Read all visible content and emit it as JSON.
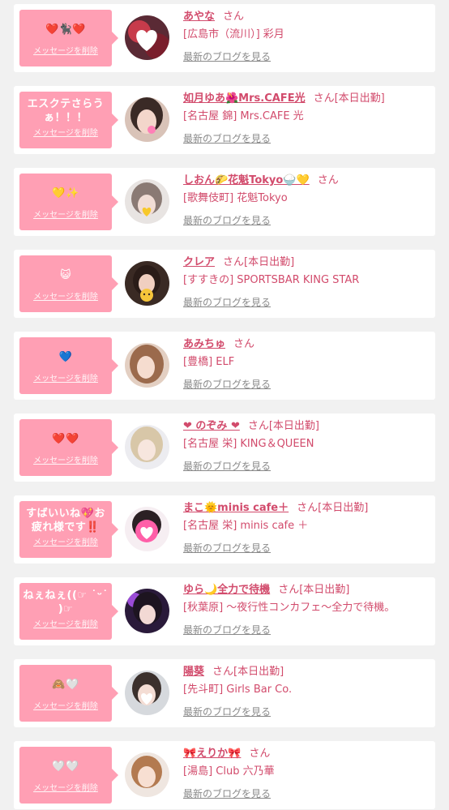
{
  "colors": {
    "page_bg": "#f1f1f1",
    "bubble_pink": "#ff9fb4",
    "name_pink": "#d24b6c",
    "link_gray": "#8a8a8a"
  },
  "delete_label": "メッセージを削除",
  "blog_label": "最新のブログを見る",
  "items": [
    {
      "message": "❤️🐈‍⬛❤️",
      "name": "あやな",
      "san": "さん",
      "tag": "",
      "shop": "[広島市（流川）] 彩月",
      "avatar_icon": "heart-sticker-avatar"
    },
    {
      "message": "エスクテさらうぁ！！！",
      "name": "如月ゆあ🌺Mrs.CAFE光",
      "san": "さん",
      "tag": "[本日出勤]",
      "shop": "[名古屋 錦] Mrs.CAFE 光",
      "avatar_icon": "heart-sticker-avatar"
    },
    {
      "message": "💛✨",
      "name": "しおん🌮花魁Tokyo🍚💛",
      "san": "さん",
      "tag": "",
      "shop": "[歌舞伎町] 花魁Tokyo",
      "avatar_icon": "heart-sticker-avatar"
    },
    {
      "message": "😺",
      "name": "クレア",
      "san": "さん",
      "tag": "[本日出勤]",
      "shop": "[すすきの] SPORTSBAR KING STAR",
      "avatar_icon": "cat-sticker-avatar"
    },
    {
      "message": "💙",
      "name": "あみちゅ",
      "san": "さん",
      "tag": "",
      "shop": "[豊橋] ELF",
      "avatar_icon": "photo-avatar"
    },
    {
      "message": "❤️❤️",
      "name": "❤ のぞみ ❤",
      "san": "さん",
      "tag": "[本日出勤]",
      "shop": "[名古屋 栄] KING＆QUEEN",
      "avatar_icon": "photo-avatar"
    },
    {
      "message": "すばいいね💖お疲れ様です‼️",
      "name": "まこ🌞minis cafe＋",
      "san": "さん",
      "tag": "[本日出勤]",
      "shop": "[名古屋 栄] minis cafe ＋",
      "avatar_icon": "heart-sticker-avatar"
    },
    {
      "message": "ねぇねぇ((☞ ˙ᵕ˙ )☞",
      "name": "ゆら🌙全力で待機",
      "san": "さん",
      "tag": "[本日出勤]",
      "shop": "[秋葉原] 〜夜行性コンカフェ〜全力で待機。",
      "avatar_icon": "photo-avatar"
    },
    {
      "message": "🙈🤍",
      "name": "陽葵",
      "san": "さん",
      "tag": "[本日出勤]",
      "shop": "[先斗町] Girls Bar Co.",
      "avatar_icon": "heart-sticker-avatar"
    },
    {
      "message": "🤍🤍",
      "name": "🎀えりか🎀",
      "san": "さん",
      "tag": "",
      "shop": "[湯島] Club 六乃華",
      "avatar_icon": "photo-avatar"
    }
  ]
}
